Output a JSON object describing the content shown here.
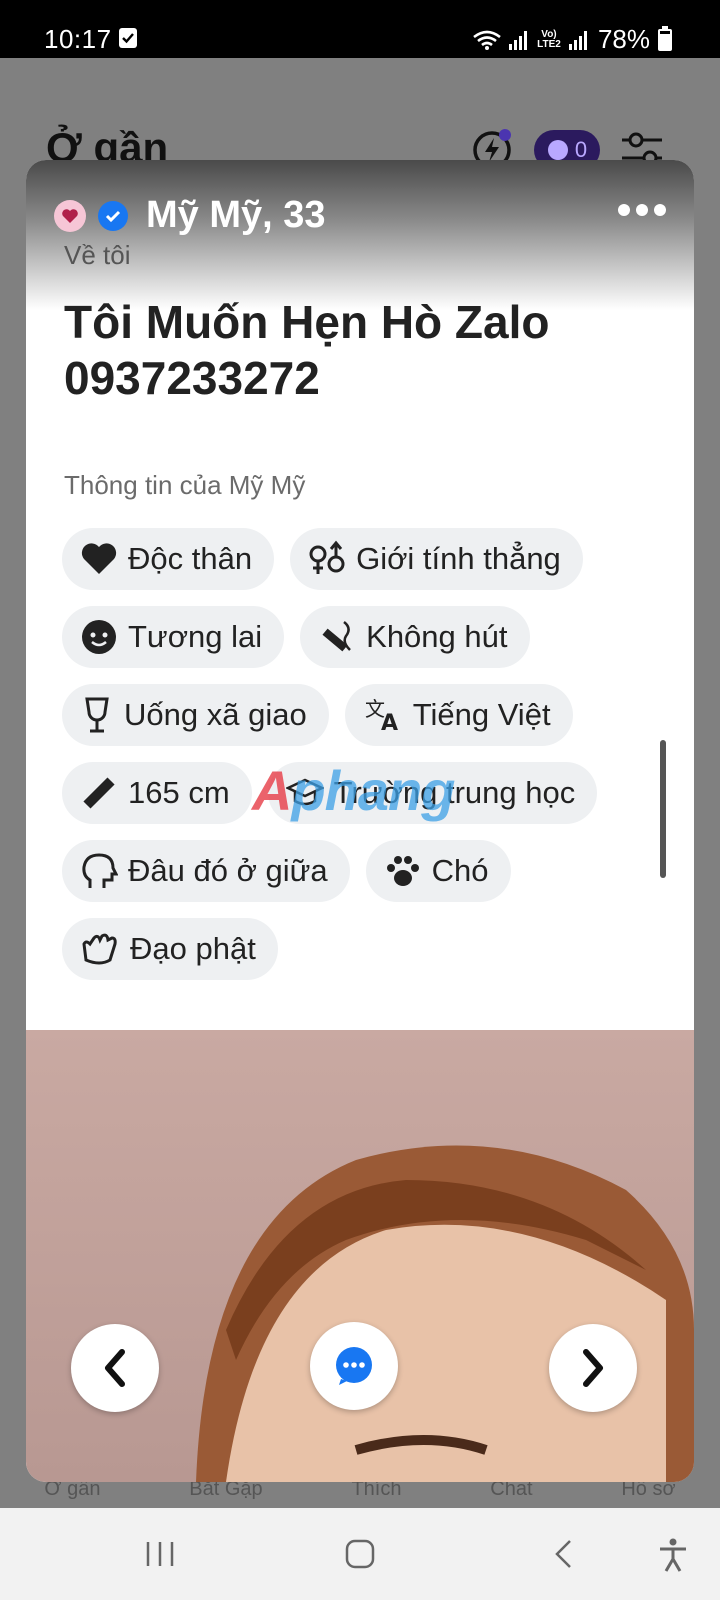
{
  "status_bar": {
    "time": "10:17",
    "network_label": "Vo)\nLTE2",
    "battery_text": "78%",
    "battery_level": 0.78
  },
  "background": {
    "header_title": "Ở gần",
    "messages_count": "0",
    "tabs": [
      "Ở gần",
      "Bắt Gặp",
      "Thích",
      "Chat",
      "Hồ sơ"
    ]
  },
  "card": {
    "name_age": "Mỹ Mỹ, 33",
    "about_label": "Về tôi",
    "about_text": "Tôi Muốn Hẹn Hò Zalo 0937233272",
    "info_label": "Thông tin của Mỹ Mỹ",
    "chips": [
      {
        "icon": "heart-icon",
        "label": "Độc thân"
      },
      {
        "icon": "gender-icon",
        "label": "Giới tính thẳng"
      },
      {
        "icon": "baby-icon",
        "label": "Tương lai"
      },
      {
        "icon": "no-smoking-icon",
        "label": "Không hút"
      },
      {
        "icon": "wine-icon",
        "label": "Uống xã giao"
      },
      {
        "icon": "translate-icon",
        "label": "Tiếng Việt"
      },
      {
        "icon": "ruler-icon",
        "label": "165 cm"
      },
      {
        "icon": "graduation-cap-icon",
        "label": "Trường trung học"
      },
      {
        "icon": "head-icon",
        "label": "Đâu đó ở giữa"
      },
      {
        "icon": "paw-icon",
        "label": "Chó"
      },
      {
        "icon": "praying-hands-icon",
        "label": "Đạo phật"
      }
    ],
    "watermark": "Anphang"
  },
  "colors": {
    "accent_blue": "#1877f2",
    "chip_bg": "#eef0f2",
    "pill_purple": "#2b1a5e"
  }
}
